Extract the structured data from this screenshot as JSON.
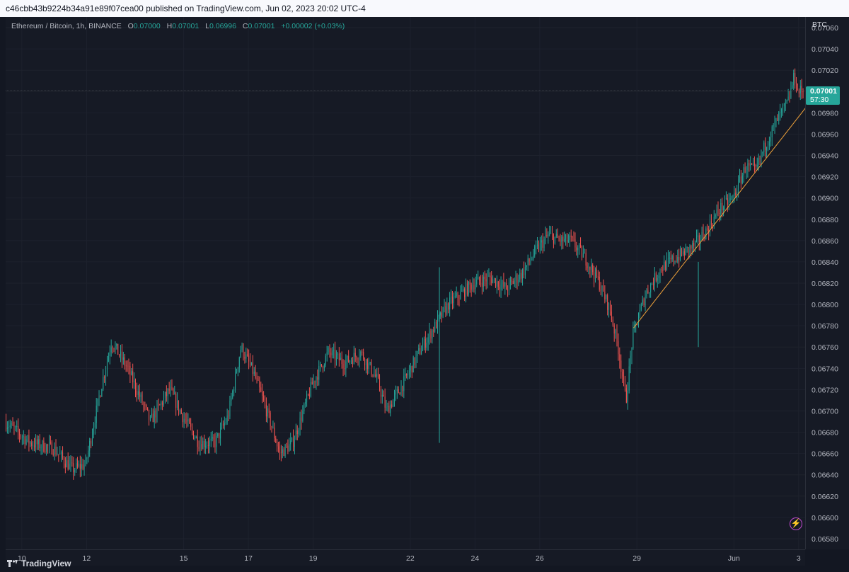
{
  "header": {
    "publish_line": "c46cbb43b9224b34a91e89f07cea00 published on TradingView.com, Jun 02, 2023 20:02 UTC-4"
  },
  "legend": {
    "symbol": "Ethereum / Bitcoin, 1h, BINANCE",
    "o_label": "O",
    "o_value": "0.07000",
    "h_label": "H",
    "h_value": "0.07001",
    "l_label": "L",
    "l_value": "0.06996",
    "c_label": "C",
    "c_value": "0.07001",
    "change": "+0.00002 (+0.03%)"
  },
  "price_axis": {
    "unit": "BTC",
    "last_price": "0.07001",
    "countdown": "57:30"
  },
  "footer": {
    "brand": "TradingView"
  },
  "icons": {
    "alert": "lightning-bolt-icon"
  },
  "colors": {
    "up": "#26a69a",
    "down": "#ef5350",
    "trendline": "#f0a23a",
    "background": "#161a25"
  },
  "chart_data": {
    "type": "candlestick",
    "title": "Ethereum / Bitcoin, 1h, BINANCE",
    "ylabel": "BTC",
    "ylim": [
      0.0657,
      0.0707
    ],
    "y_ticks": [
      "0.07060",
      "0.07040",
      "0.07020",
      "0.07000",
      "0.06980",
      "0.06960",
      "0.06940",
      "0.06920",
      "0.06900",
      "0.06880",
      "0.06860",
      "0.06840",
      "0.06820",
      "0.06800",
      "0.06780",
      "0.06760",
      "0.06740",
      "0.06720",
      "0.06700",
      "0.06680",
      "0.06660",
      "0.06640",
      "0.06620",
      "0.06600",
      "0.06580"
    ],
    "x_ticks": [
      "10",
      "12",
      "15",
      "17",
      "19",
      "22",
      "24",
      "26",
      "29",
      "Jun",
      "3"
    ],
    "x_tick_days": [
      10,
      12,
      15,
      17,
      19,
      22,
      24,
      26,
      29,
      32,
      34
    ],
    "x_range_days": [
      9.5,
      34.2
    ],
    "grid": true,
    "last_price": 0.07001,
    "trend_line": {
      "from": [
        "29",
        0.06778
      ],
      "to": [
        "Jun 2",
        0.06988
      ]
    },
    "path_keypoints": [
      [
        9.5,
        0.0669
      ],
      [
        10.3,
        0.0667
      ],
      [
        11.0,
        0.06665
      ],
      [
        11.6,
        0.06645
      ],
      [
        12.0,
        0.0665
      ],
      [
        12.5,
        0.06725
      ],
      [
        12.8,
        0.06765
      ],
      [
        13.3,
        0.0674
      ],
      [
        14.0,
        0.0669
      ],
      [
        14.6,
        0.0672
      ],
      [
        15.0,
        0.06695
      ],
      [
        15.5,
        0.0667
      ],
      [
        16.0,
        0.0667
      ],
      [
        16.4,
        0.06695
      ],
      [
        16.8,
        0.0676
      ],
      [
        17.2,
        0.06735
      ],
      [
        17.7,
        0.0669
      ],
      [
        18.0,
        0.0666
      ],
      [
        18.4,
        0.0667
      ],
      [
        19.0,
        0.06725
      ],
      [
        19.5,
        0.06755
      ],
      [
        20.0,
        0.06745
      ],
      [
        20.5,
        0.06755
      ],
      [
        21.0,
        0.0673
      ],
      [
        21.3,
        0.067
      ],
      [
        21.8,
        0.06725
      ],
      [
        22.3,
        0.06755
      ],
      [
        22.8,
        0.0678
      ],
      [
        23.2,
        0.068
      ],
      [
        23.6,
        0.0681
      ],
      [
        24.0,
        0.0682
      ],
      [
        24.5,
        0.06825
      ],
      [
        25.0,
        0.06815
      ],
      [
        25.5,
        0.0683
      ],
      [
        25.9,
        0.0685
      ],
      [
        26.3,
        0.06865
      ],
      [
        26.7,
        0.0686
      ],
      [
        27.0,
        0.0686
      ],
      [
        27.4,
        0.06845
      ],
      [
        27.8,
        0.06825
      ],
      [
        28.2,
        0.06795
      ],
      [
        28.45,
        0.0676
      ],
      [
        28.7,
        0.0671
      ],
      [
        28.9,
        0.0677
      ],
      [
        29.3,
        0.0681
      ],
      [
        29.8,
        0.06835
      ],
      [
        30.3,
        0.06845
      ],
      [
        30.8,
        0.06855
      ],
      [
        31.2,
        0.0687
      ],
      [
        31.6,
        0.0689
      ],
      [
        32.0,
        0.069
      ],
      [
        32.4,
        0.0693
      ],
      [
        32.7,
        0.06925
      ],
      [
        33.0,
        0.0695
      ],
      [
        33.4,
        0.06975
      ],
      [
        33.7,
        0.0699
      ],
      [
        33.9,
        0.07015
      ],
      [
        34.0,
        0.07
      ],
      [
        34.15,
        0.07001
      ]
    ],
    "wick_spikes": [
      {
        "day": 22.9,
        "low": 0.0667,
        "high": 0.06835
      },
      {
        "day": 30.9,
        "low": 0.0676,
        "high": 0.0684
      }
    ]
  }
}
